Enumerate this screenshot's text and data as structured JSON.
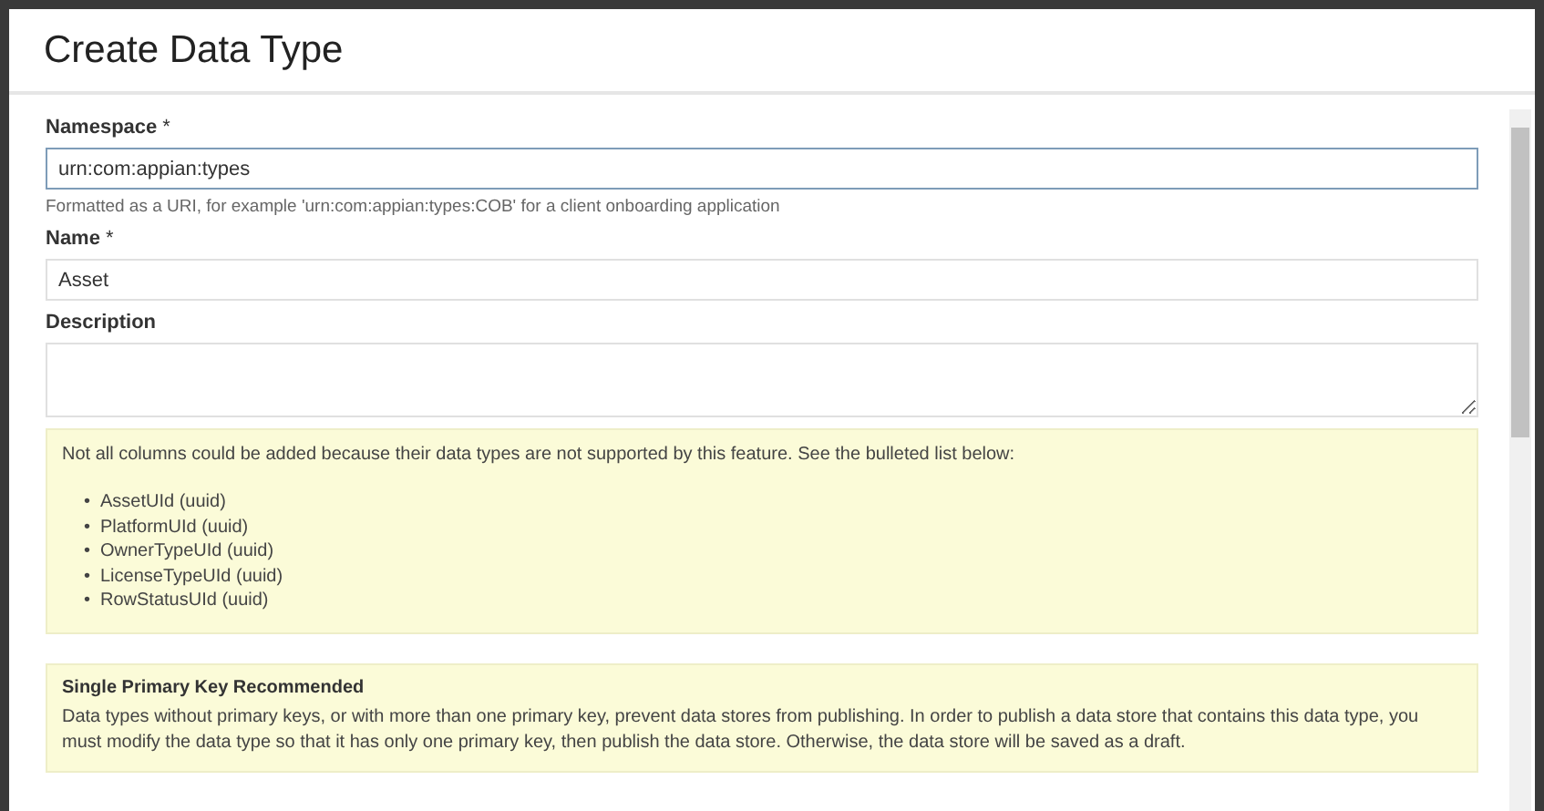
{
  "dialog": {
    "title": "Create Data Type"
  },
  "fields": [
    {
      "kind": "input",
      "label": "Namespace",
      "required_mark": "*",
      "value": "urn:com:appian:types",
      "focused": true,
      "hint": "Formatted as a URI, for example 'urn:com:appian:types:COB' for a client onboarding application"
    },
    {
      "kind": "input",
      "label": "Name",
      "required_mark": "*",
      "value": "Asset",
      "focused": false
    },
    {
      "kind": "textarea",
      "label": "Description",
      "focused": false
    }
  ],
  "unsupported_notice": {
    "message": "Not all columns could be added because their data types are not supported by this feature. See the bulleted list below:",
    "bullet": "•",
    "items": [
      "AssetUId (uuid)",
      "PlatformUId (uuid)",
      "OwnerTypeUId (uuid)",
      "LicenseTypeUId (uuid)",
      "RowStatusUId (uuid)"
    ]
  },
  "primary_key_notice": {
    "title": "Single Primary Key Recommended",
    "message": "Data types without primary keys, or with more than one primary key, prevent data stores from publishing. In order to publish a data store that contains this data type, you must modify the data type so that it has only one primary key, then publish the data store. Otherwise, the data store will be saved as a draft."
  }
}
